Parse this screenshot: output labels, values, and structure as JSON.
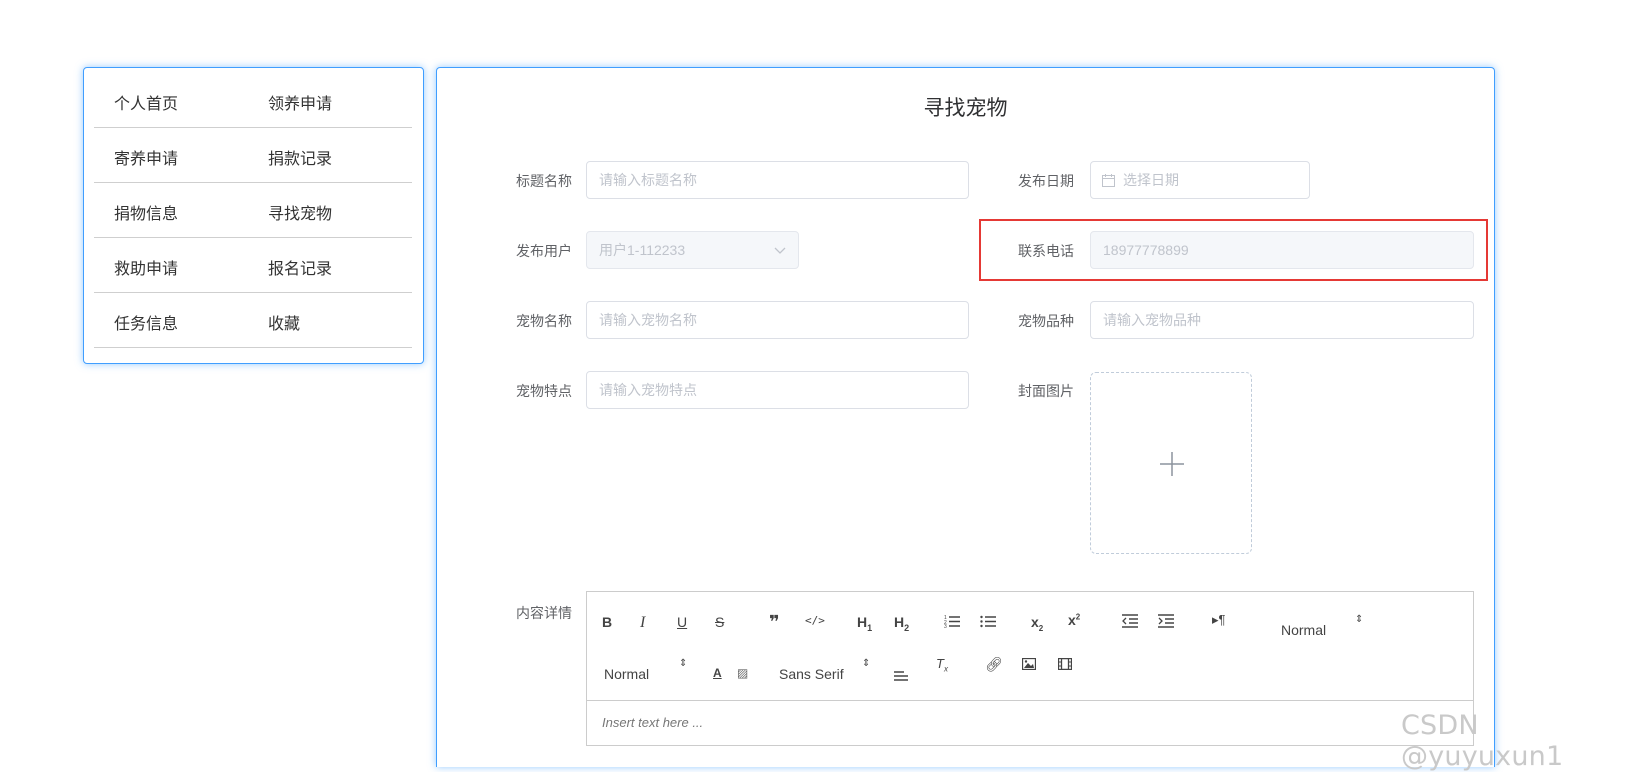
{
  "sidebar": {
    "rows": [
      {
        "left": "个人首页",
        "right": "领养申请"
      },
      {
        "left": "寄养申请",
        "right": "捐款记录"
      },
      {
        "left": "捐物信息",
        "right": "寻找宠物"
      },
      {
        "left": "救助申请",
        "right": "报名记录"
      },
      {
        "left": "任务信息",
        "right": "收藏"
      }
    ]
  },
  "form": {
    "title": "寻找宠物",
    "title_name": {
      "label": "标题名称",
      "placeholder": "请输入标题名称"
    },
    "publish_date": {
      "label": "发布日期",
      "placeholder": "选择日期"
    },
    "publish_user": {
      "label": "发布用户",
      "value": "用户1-112233"
    },
    "phone": {
      "label": "联系电话",
      "value": "18977778899"
    },
    "pet_name": {
      "label": "宠物名称",
      "placeholder": "请输入宠物名称"
    },
    "pet_breed": {
      "label": "宠物品种",
      "placeholder": "请输入宠物品种"
    },
    "pet_feature": {
      "label": "宠物特点",
      "placeholder": "请输入宠物特点"
    },
    "cover": {
      "label": "封面图片"
    },
    "content": {
      "label": "内容详情"
    }
  },
  "editor": {
    "header_picker": "Normal",
    "size_picker": "Normal",
    "font_picker": "Sans Serif",
    "placeholder": "Insert text here ..."
  },
  "watermark": "CSDN @yuyuxun1"
}
